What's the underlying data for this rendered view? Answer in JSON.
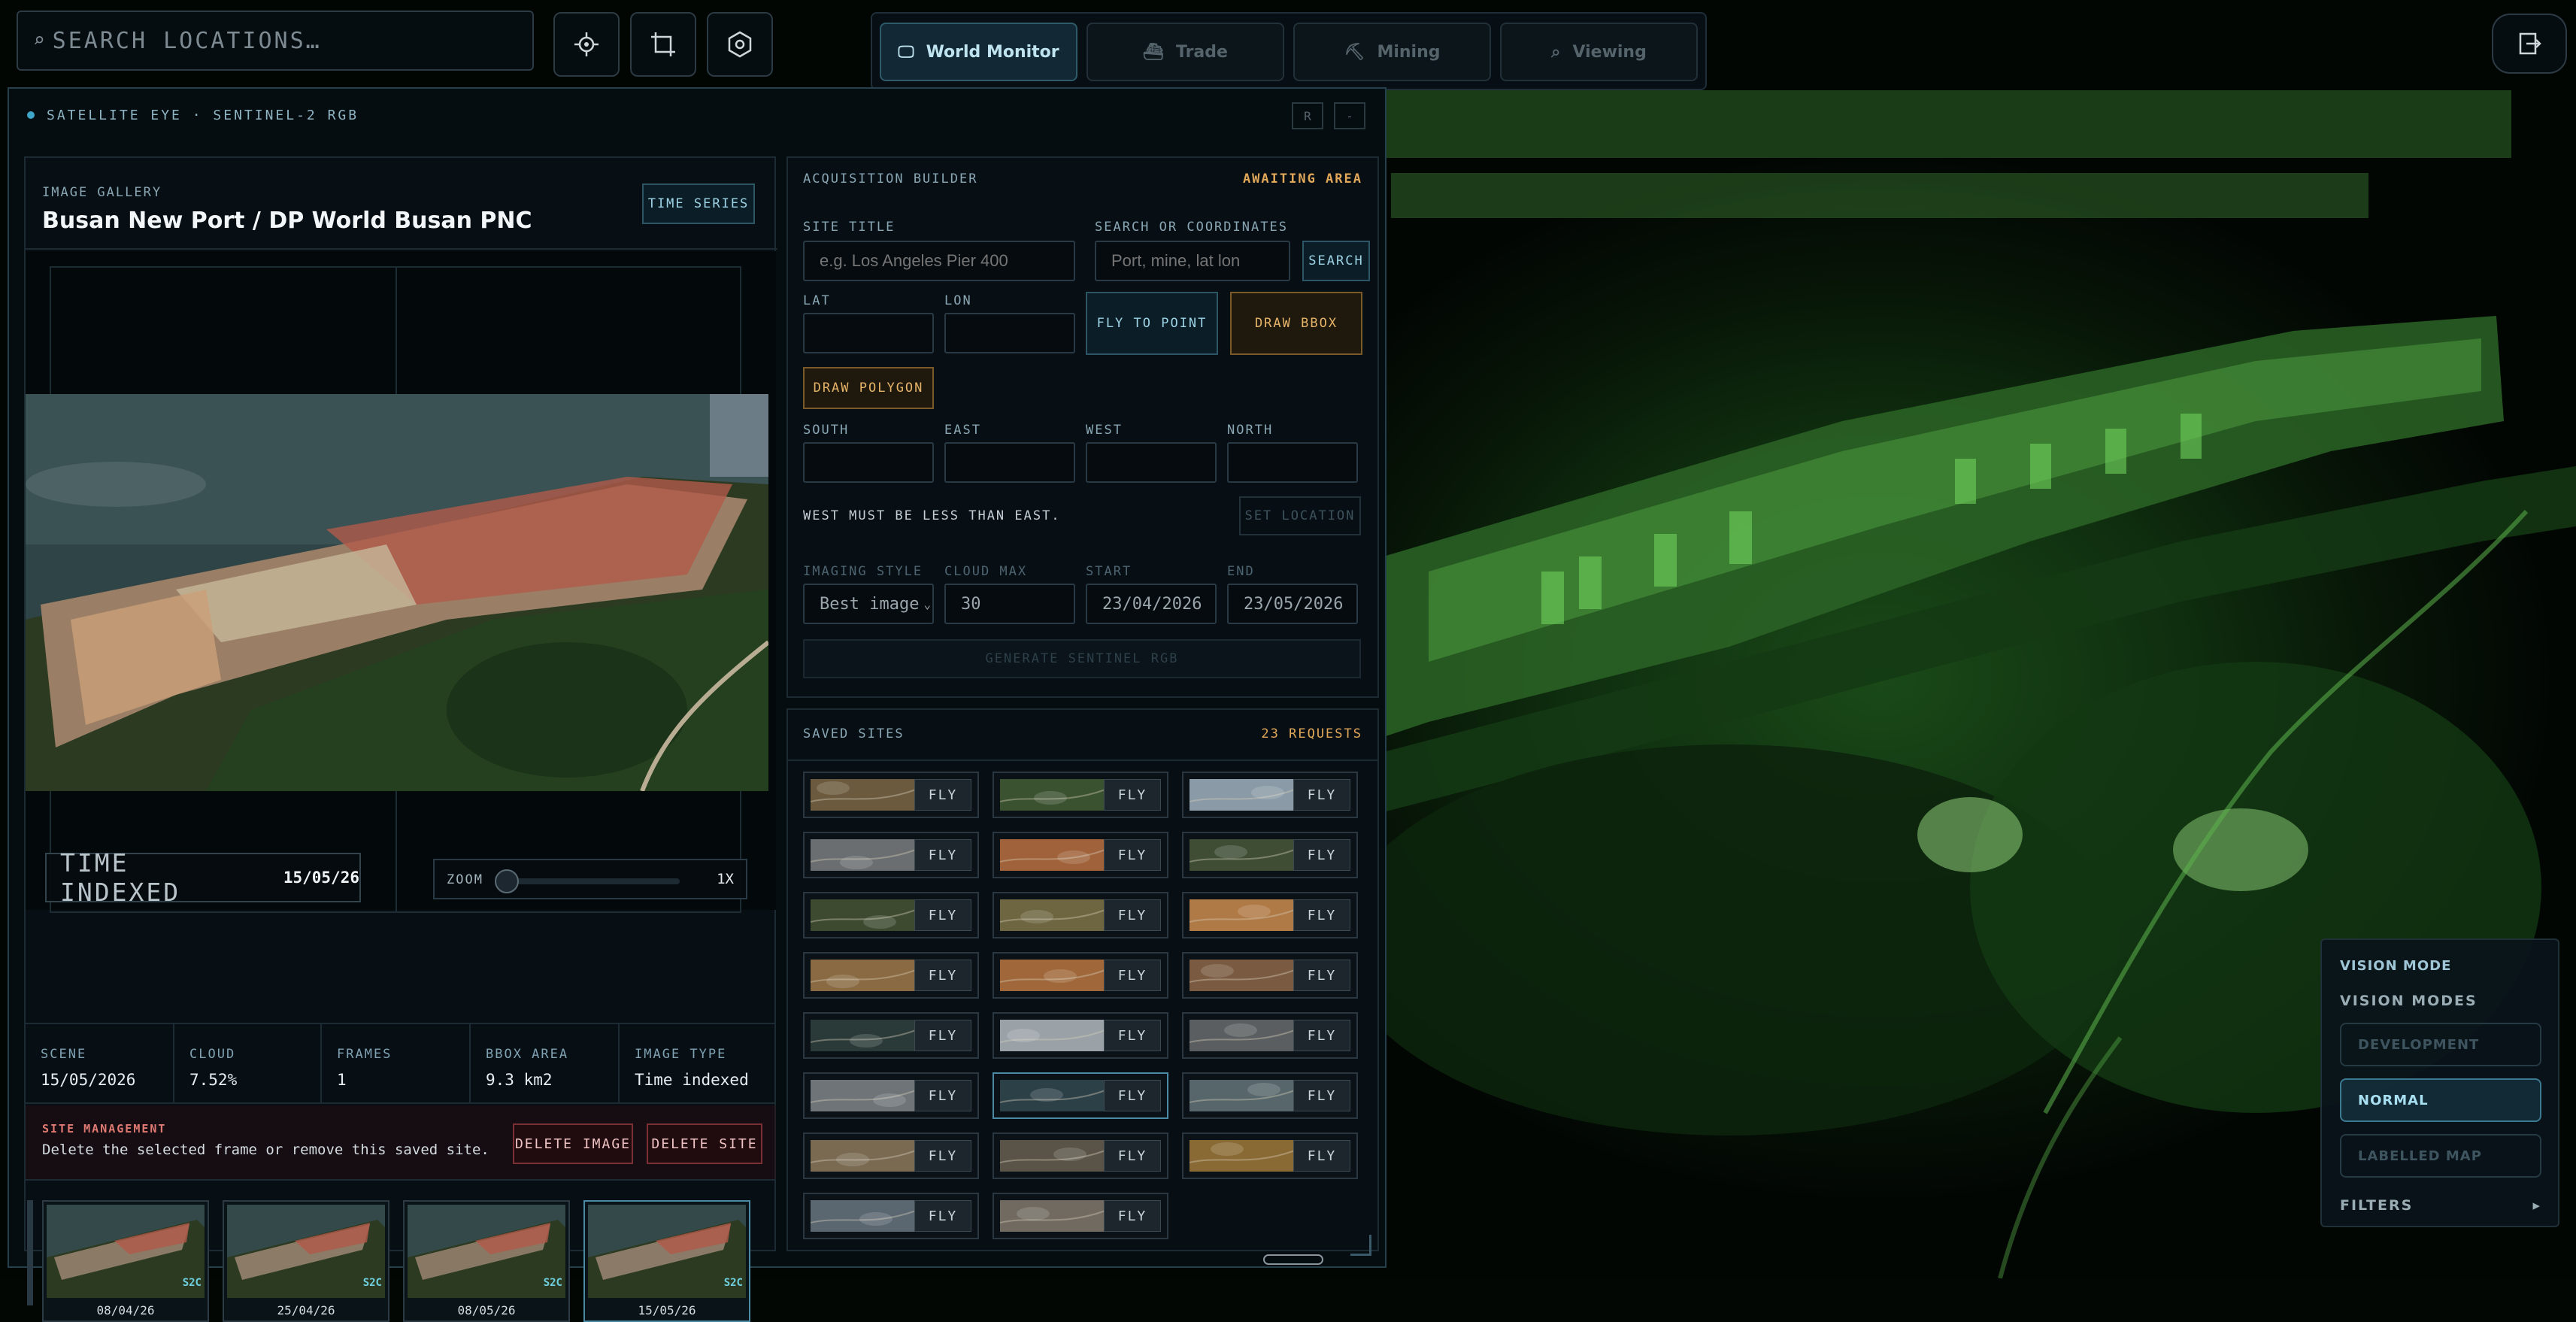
{
  "top": {
    "search_placeholder": "SEARCH LOCATIONS…",
    "tools": [
      {
        "icon": "crosshair-icon"
      },
      {
        "icon": "crop-icon"
      },
      {
        "icon": "hexagon-settings-icon"
      }
    ],
    "tabs": [
      {
        "label": "World Monitor",
        "icon": "monitor-icon",
        "active": true
      },
      {
        "label": "Trade",
        "icon": "ship-icon",
        "active": false
      },
      {
        "label": "Mining",
        "icon": "pickaxe-icon",
        "active": false
      },
      {
        "label": "Viewing",
        "icon": "magnifier-icon",
        "active": false
      }
    ],
    "exit_icon": "exit-icon"
  },
  "panel": {
    "title": "SATELLITE EYE · SENTINEL-2 RGB",
    "header_buttons": [
      "R",
      "-"
    ],
    "gallery": {
      "kicker": "IMAGE GALLERY",
      "title": "Busan New Port / DP World Busan PNC",
      "time_series_label": "TIME SERIES",
      "time_indexed_label": "TIME INDEXED",
      "time_indexed_date": "15/05/26",
      "zoom_label": "ZOOM",
      "zoom_value": "1X",
      "zoom_level": 0.0
    },
    "stats": [
      {
        "key": "SCENE",
        "value": "15/05/2026"
      },
      {
        "key": "CLOUD",
        "value": "7.52%"
      },
      {
        "key": "FRAMES",
        "value": "1"
      },
      {
        "key": "BBOX AREA",
        "value": "9.3 km2"
      },
      {
        "key": "IMAGE TYPE",
        "value": "Time indexed"
      }
    ],
    "site_management": {
      "title": "SITE MANAGEMENT",
      "description": "Delete the selected frame or remove this saved site.",
      "delete_image": "DELETE IMAGE",
      "delete_site": "DELETE SITE"
    },
    "filmstrip": [
      {
        "date": "08/04/26",
        "badge": "S2C",
        "selected": false
      },
      {
        "date": "25/04/26",
        "badge": "S2C",
        "selected": false
      },
      {
        "date": "08/05/26",
        "badge": "S2C",
        "selected": false
      },
      {
        "date": "15/05/26",
        "badge": "S2C",
        "selected": true
      }
    ],
    "builder": {
      "title": "ACQUISITION BUILDER",
      "status": "AWAITING AREA",
      "site_title_label": "SITE TITLE",
      "site_title_placeholder": "e.g. Los Angeles Pier 400",
      "search_label": "SEARCH OR COORDINATES",
      "search_placeholder": "Port, mine, lat lon",
      "search_button": "SEARCH",
      "lat_label": "LAT",
      "lon_label": "LON",
      "fly_to_point": "FLY TO POINT",
      "draw_bbox": "DRAW BBOX",
      "draw_polygon": "DRAW POLYGON",
      "south_label": "SOUTH",
      "east_label": "EAST",
      "west_label": "WEST",
      "north_label": "NORTH",
      "validation": "WEST MUST BE LESS THAN EAST.",
      "set_location": "SET LOCATION",
      "imaging_style_label": "IMAGING STYLE",
      "imaging_style_value": "Best image",
      "cloud_max_label": "CLOUD MAX",
      "cloud_max_value": "30",
      "start_label": "START",
      "start_value": "23/04/2026",
      "end_label": "END",
      "end_value": "23/05/2026",
      "generate": "GENERATE SENTINEL RGB"
    },
    "saved_sites": {
      "title": "SAVED SITES",
      "requests": "23 REQUESTS",
      "fly_label": "FLY",
      "sites": [
        {
          "tone": "#6b5a3e"
        },
        {
          "tone": "#3b5230"
        },
        {
          "tone": "#8a9aa6"
        },
        {
          "tone": "#6a6e70"
        },
        {
          "tone": "#a0623a"
        },
        {
          "tone": "#3e4d34"
        },
        {
          "tone": "#3d4a30"
        },
        {
          "tone": "#6d6640"
        },
        {
          "tone": "#b07a46"
        },
        {
          "tone": "#8a6a42"
        },
        {
          "tone": "#a0683a"
        },
        {
          "tone": "#7a5a40"
        },
        {
          "tone": "#2a3a38"
        },
        {
          "tone": "#9aa2a8"
        },
        {
          "tone": "#5a5e60"
        },
        {
          "tone": "#6e7478"
        },
        {
          "tone": "#2c4048"
        },
        {
          "tone": "#56666a"
        },
        {
          "tone": "#7a6a52"
        },
        {
          "tone": "#5a5448"
        },
        {
          "tone": "#8a6a34"
        },
        {
          "tone": "#5a6670"
        },
        {
          "tone": "#706a60"
        }
      ]
    }
  },
  "vision": {
    "title": "VISION MODE",
    "subtitle": "VISION MODES",
    "modes": [
      {
        "label": "DEVELOPMENT",
        "active": false
      },
      {
        "label": "NORMAL",
        "active": true
      },
      {
        "label": "LABELLED MAP",
        "active": false
      }
    ],
    "filters": "FILTERS"
  }
}
